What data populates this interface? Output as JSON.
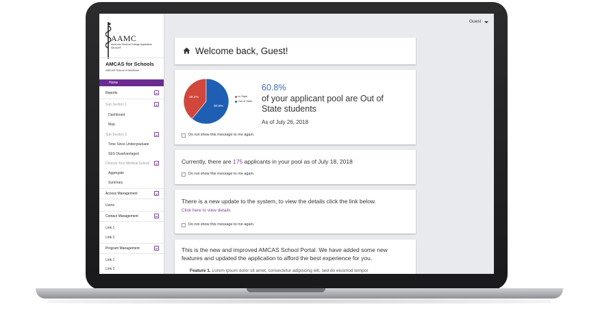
{
  "header": {
    "user_label": "Guest"
  },
  "logo": {
    "wordmark": "AAMC",
    "tagline": "American Medical College Application Service®"
  },
  "sidebar": {
    "title": "AMCAS for Schools",
    "subtitle": "AMCAS School of Medicine",
    "home": "Home",
    "items": [
      {
        "label": "Reports"
      },
      {
        "label": "Sub Section 1"
      },
      {
        "label": "Dashboard"
      },
      {
        "label": "Map"
      },
      {
        "label": "Sub Section 2"
      },
      {
        "label": "Time Since Undergraduate"
      },
      {
        "label": "SES Disadvantaged"
      },
      {
        "label": "Choose Your Medical School"
      },
      {
        "label": "Aggregate"
      },
      {
        "label": "Summary"
      },
      {
        "label": "Access Management"
      },
      {
        "label": "Users"
      },
      {
        "label": "Contact Management"
      },
      {
        "label": "Link 1"
      },
      {
        "label": "Link 2"
      },
      {
        "label": "Program Management"
      },
      {
        "label": "Link 1"
      },
      {
        "label": "Link 2"
      }
    ]
  },
  "welcome": {
    "text": "Welcome back, Guest!"
  },
  "pie_card": {
    "percent": "60.8%",
    "description": "of your applicant pool are Out of State students",
    "as_of": "As of July 26, 2018",
    "checkbox_label": "Do not show this message to me again.",
    "slice_labels": [
      "39.2%",
      "60.8%"
    ],
    "legend": [
      "In State",
      "Out of State"
    ],
    "colors": {
      "in_state": "#d2473b",
      "out_of_state": "#1f5fb3"
    }
  },
  "chart_data": {
    "type": "pie",
    "categories": [
      "In State",
      "Out of State"
    ],
    "values": [
      39.2,
      60.8
    ]
  },
  "applicants_card": {
    "prefix": "Currently, there are",
    "count": "175",
    "suffix": "applicants in your pool as of July 18, 2018",
    "checkbox_label": "Do not show this message to me again."
  },
  "update_card": {
    "text": "There is a new update to the system, to view the details click the link below.",
    "link": "Click here to view details",
    "checkbox_label": "Do not show this message to me again."
  },
  "news_card": {
    "text": "This is the new and improved AMCAS School Portal. We have added some new features and updated the application to afford the best experience for you.",
    "feature_title": "Feature 1.",
    "feature_text": "Lorem ipsum dolor sit amet, consectetur adipiscing elit, sed do eiusmod tempor"
  },
  "accent_color": "#6a2c91"
}
